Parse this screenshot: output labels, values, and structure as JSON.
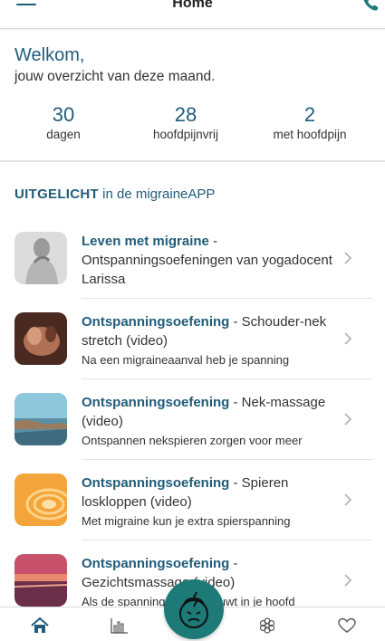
{
  "header": {
    "title": "Home",
    "menu_icon": "hamburger-menu-icon",
    "phone_icon": "phone-icon",
    "accent_color": "#1f5c7a"
  },
  "welcome": {
    "title": "Welkom,",
    "subtitle": "jouw overzicht van deze maand."
  },
  "stats": [
    {
      "value": "30",
      "label": "dagen"
    },
    {
      "value": "28",
      "label": "hoofdpijnvrij"
    },
    {
      "value": "2",
      "label": "met hoofdpijn"
    }
  ],
  "featured": {
    "heading_bold": "UITGELICHT",
    "heading_rest": "in de migraineAPP"
  },
  "items": [
    {
      "title": "Leven met migraine",
      "title_rest": " - Ontspanningsoefeningen van yogadocent Larissa",
      "subtitle": ""
    },
    {
      "title": "Ontspanningsoefening",
      "title_rest": " - Schouder-nek stretch (video)",
      "subtitle": "Na een migraineaanval heb je spanning"
    },
    {
      "title": "Ontspanningsoefening",
      "title_rest": " - Nek-massage (video)",
      "subtitle": "Ontspannen nekspieren zorgen voor meer"
    },
    {
      "title": "Ontspanningsoefening",
      "title_rest": " - Spieren loskloppen (video)",
      "subtitle": "Met migraine kun je extra spierspanning"
    },
    {
      "title": "Ontspanningsoefening",
      "title_rest": " - Gezichtsmassage (video)",
      "subtitle": "Als de spanning zich opbouwt in je hoofd"
    }
  ],
  "tabbar": {
    "tabs": [
      "home-icon",
      "chart-icon",
      "headache-log-icon",
      "flower-icon",
      "heart-icon"
    ],
    "fab_color": "#1d7a77"
  }
}
